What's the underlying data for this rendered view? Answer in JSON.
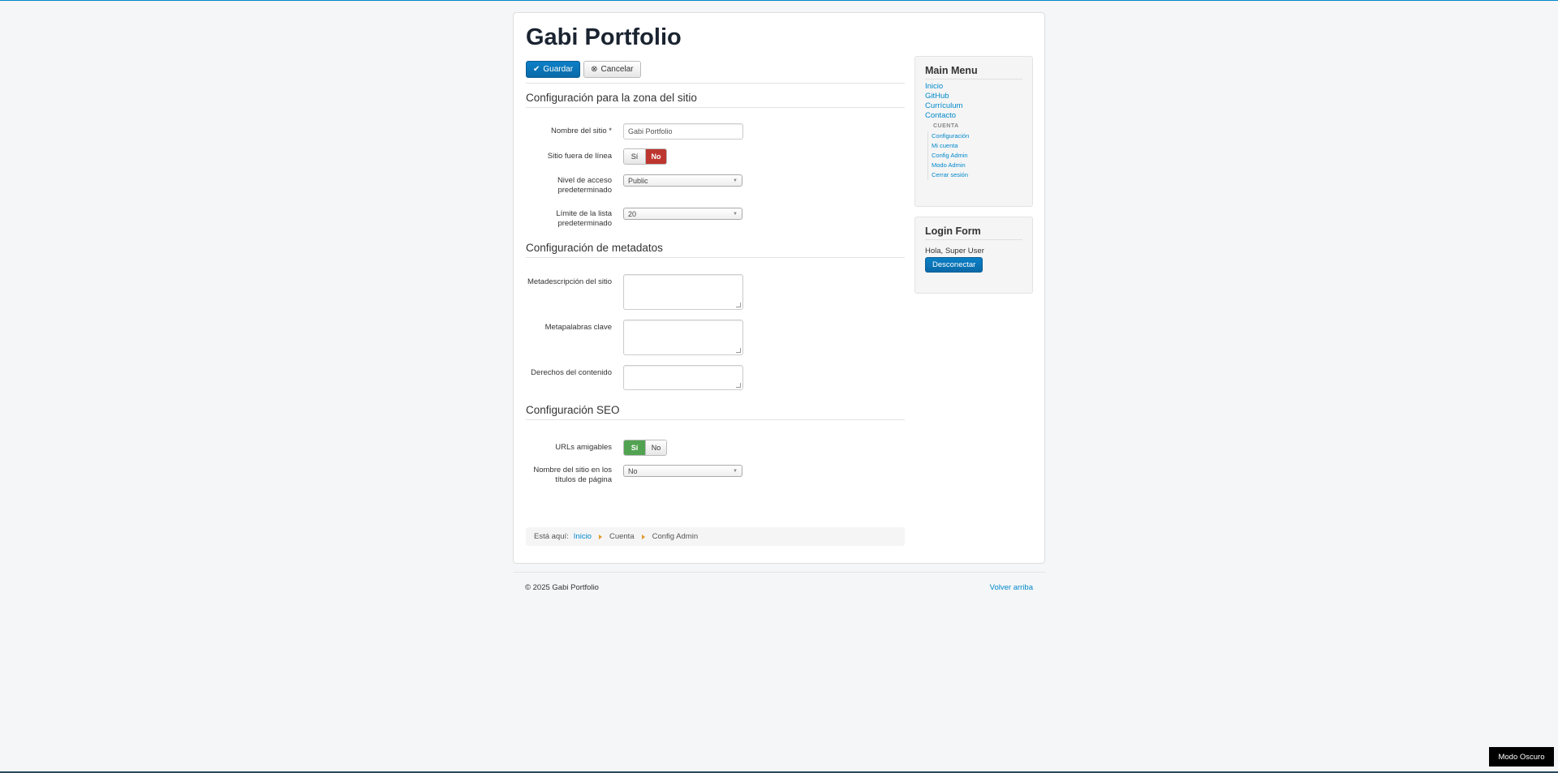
{
  "header": {
    "site_title": "Gabi Portfolio"
  },
  "toolbar": {
    "save_label": "Guardar",
    "save_icon": "check-icon",
    "cancel_label": "Cancelar",
    "cancel_icon": "circle-x-icon"
  },
  "sections": {
    "site": "Configuración para la zona del sitio",
    "metadata": "Configuración de metadatos",
    "seo": "Configuración SEO"
  },
  "site_fields": {
    "site_name_label": "Nombre del sitio *",
    "site_name_value": "Gabi Portfolio",
    "offline_label": "Sitio fuera de línea",
    "offline_yes": "Sí",
    "offline_no": "No",
    "offline_selected": "No",
    "access_label_1": "Nivel de acceso",
    "access_label_2": "predeterminado",
    "access_value": "Public",
    "list_limit_label_1": "Límite de la lista",
    "list_limit_label_2": "predeterminado",
    "list_limit_value": "20"
  },
  "meta_fields": {
    "description_label": "Metadescripción del sitio",
    "keywords_label": "Metapalabras clave",
    "rights_label": "Derechos del contenido"
  },
  "seo_fields": {
    "sef_label": "URLs amigables",
    "sef_yes": "Sí",
    "sef_no": "No",
    "sef_selected": "Sí",
    "sitename_label_1": "Nombre del sitio en los",
    "sitename_label_2": "títulos de página",
    "sitename_value": "No"
  },
  "breadcrumb": {
    "prefix": "Está aquí:",
    "items": [
      "Inicio",
      "Cuenta",
      "Config Admin"
    ]
  },
  "main_menu": {
    "title": "Main Menu",
    "items": [
      "Inicio",
      "GitHub",
      "Currículum",
      "Contacto"
    ],
    "sub_header": "CUENTA",
    "sub_items": [
      "Configuración",
      "Mi cuenta",
      "Config Admin",
      "Modo Admin",
      "Cerrar sesión"
    ]
  },
  "login_form": {
    "title": "Login Form",
    "greeting": "Hola, Super User",
    "logout_label": "Desconectar"
  },
  "footer": {
    "copyright": "© 2025 Gabi Portfolio",
    "back_to_top": "Volver arriba"
  },
  "dark_mode_label": "Modo Oscuro",
  "colors": {
    "accent": "#0088cc",
    "danger": "#bd362f",
    "success": "#51a351"
  }
}
